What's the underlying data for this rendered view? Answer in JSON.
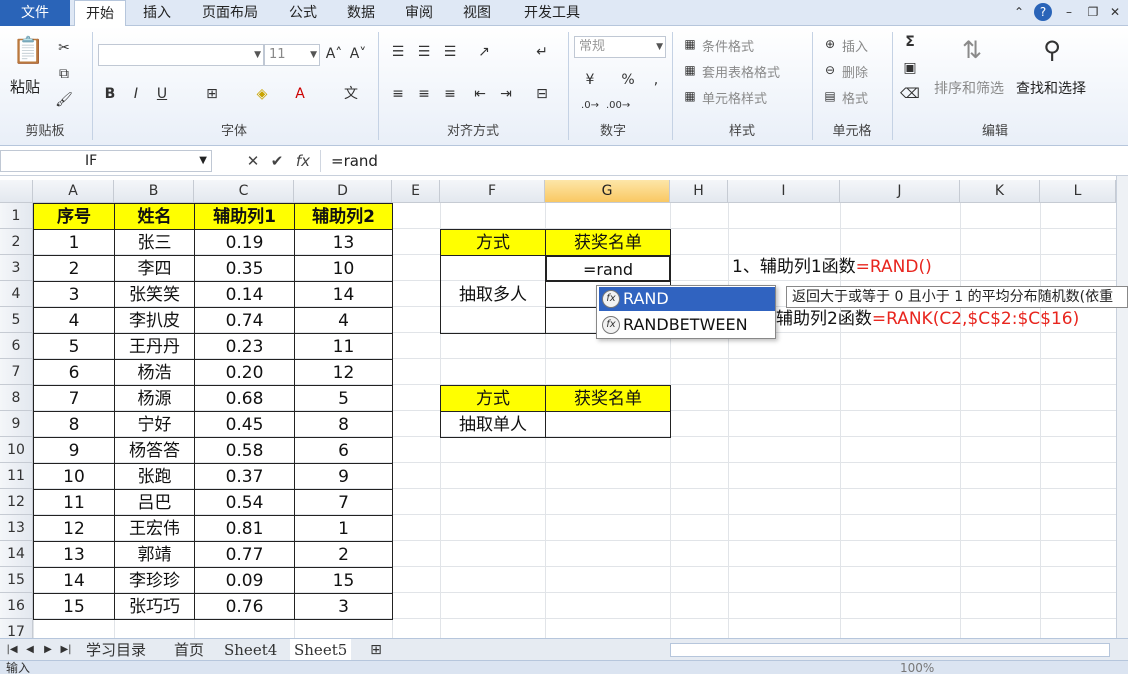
{
  "menubar": {
    "tabs": [
      "文件",
      "开始",
      "插入",
      "页面布局",
      "公式",
      "数据",
      "审阅",
      "视图",
      "开发工具"
    ]
  },
  "ribbon": {
    "paste": "粘贴",
    "clipboard": "剪贴板",
    "font_group": "字体",
    "font_size": "11",
    "align_group": "对齐方式",
    "number_format": "常规",
    "number_group": "数字",
    "percent": "%",
    "cond_format": "条件格式",
    "table_format": "套用表格格式",
    "cell_style": "单元格样式",
    "style_group": "样式",
    "insert": "插入",
    "delete": "删除",
    "format": "格式",
    "cells_group": "单元格",
    "sort_filter": "排序和筛选",
    "find_select": "查找和选择",
    "edit_group": "编辑"
  },
  "formula": {
    "namebox": "IF",
    "value": "=rand"
  },
  "columns": [
    "A",
    "B",
    "C",
    "D",
    "E",
    "F",
    "G",
    "H",
    "I",
    "J",
    "K",
    "L"
  ],
  "rows": [
    "1",
    "2",
    "3",
    "4",
    "5",
    "6",
    "7",
    "8",
    "9",
    "10",
    "11",
    "12",
    "13",
    "14",
    "15",
    "16",
    "17"
  ],
  "table": {
    "headers": [
      "序号",
      "姓名",
      "辅助列1",
      "辅助列2"
    ],
    "rows": [
      [
        "1",
        "张三",
        "0.19",
        "13"
      ],
      [
        "2",
        "李四",
        "0.35",
        "10"
      ],
      [
        "3",
        "张笑笑",
        "0.14",
        "14"
      ],
      [
        "4",
        "李扒皮",
        "0.74",
        "4"
      ],
      [
        "5",
        "王丹丹",
        "0.23",
        "11"
      ],
      [
        "6",
        "杨浩",
        "0.20",
        "12"
      ],
      [
        "7",
        "杨源",
        "0.68",
        "5"
      ],
      [
        "8",
        "宁好",
        "0.45",
        "8"
      ],
      [
        "9",
        "杨答答",
        "0.58",
        "6"
      ],
      [
        "10",
        "张跑",
        "0.37",
        "9"
      ],
      [
        "11",
        "吕巴",
        "0.54",
        "7"
      ],
      [
        "12",
        "王宏伟",
        "0.81",
        "1"
      ],
      [
        "13",
        "郭靖",
        "0.77",
        "2"
      ],
      [
        "14",
        "李珍珍",
        "0.09",
        "15"
      ],
      [
        "15",
        "张巧巧",
        "0.76",
        "3"
      ]
    ]
  },
  "draw1": {
    "method": "方式",
    "winners": "获奖名单",
    "label": "抽取多人",
    "editing": "=rand"
  },
  "draw2": {
    "method": "方式",
    "winners": "获奖名单",
    "label": "抽取单人"
  },
  "notes": {
    "n1_prefix": "1、辅助列1函数",
    "n1_formula": "=RAND()",
    "n2_prefix": "辅助列2函数",
    "n2_formula": "=RANK(C2,$C$2:$C$16)"
  },
  "autocomplete": {
    "items": [
      "RAND",
      "RANDBETWEEN"
    ]
  },
  "tooltip": "返回大于或等于 0 且小于 1 的平均分布随机数(依重",
  "sheet_tabs": [
    "学习目录",
    "首页",
    "Sheet4",
    "Sheet5"
  ],
  "status": {
    "mode": "输入",
    "zoom": "100%"
  }
}
